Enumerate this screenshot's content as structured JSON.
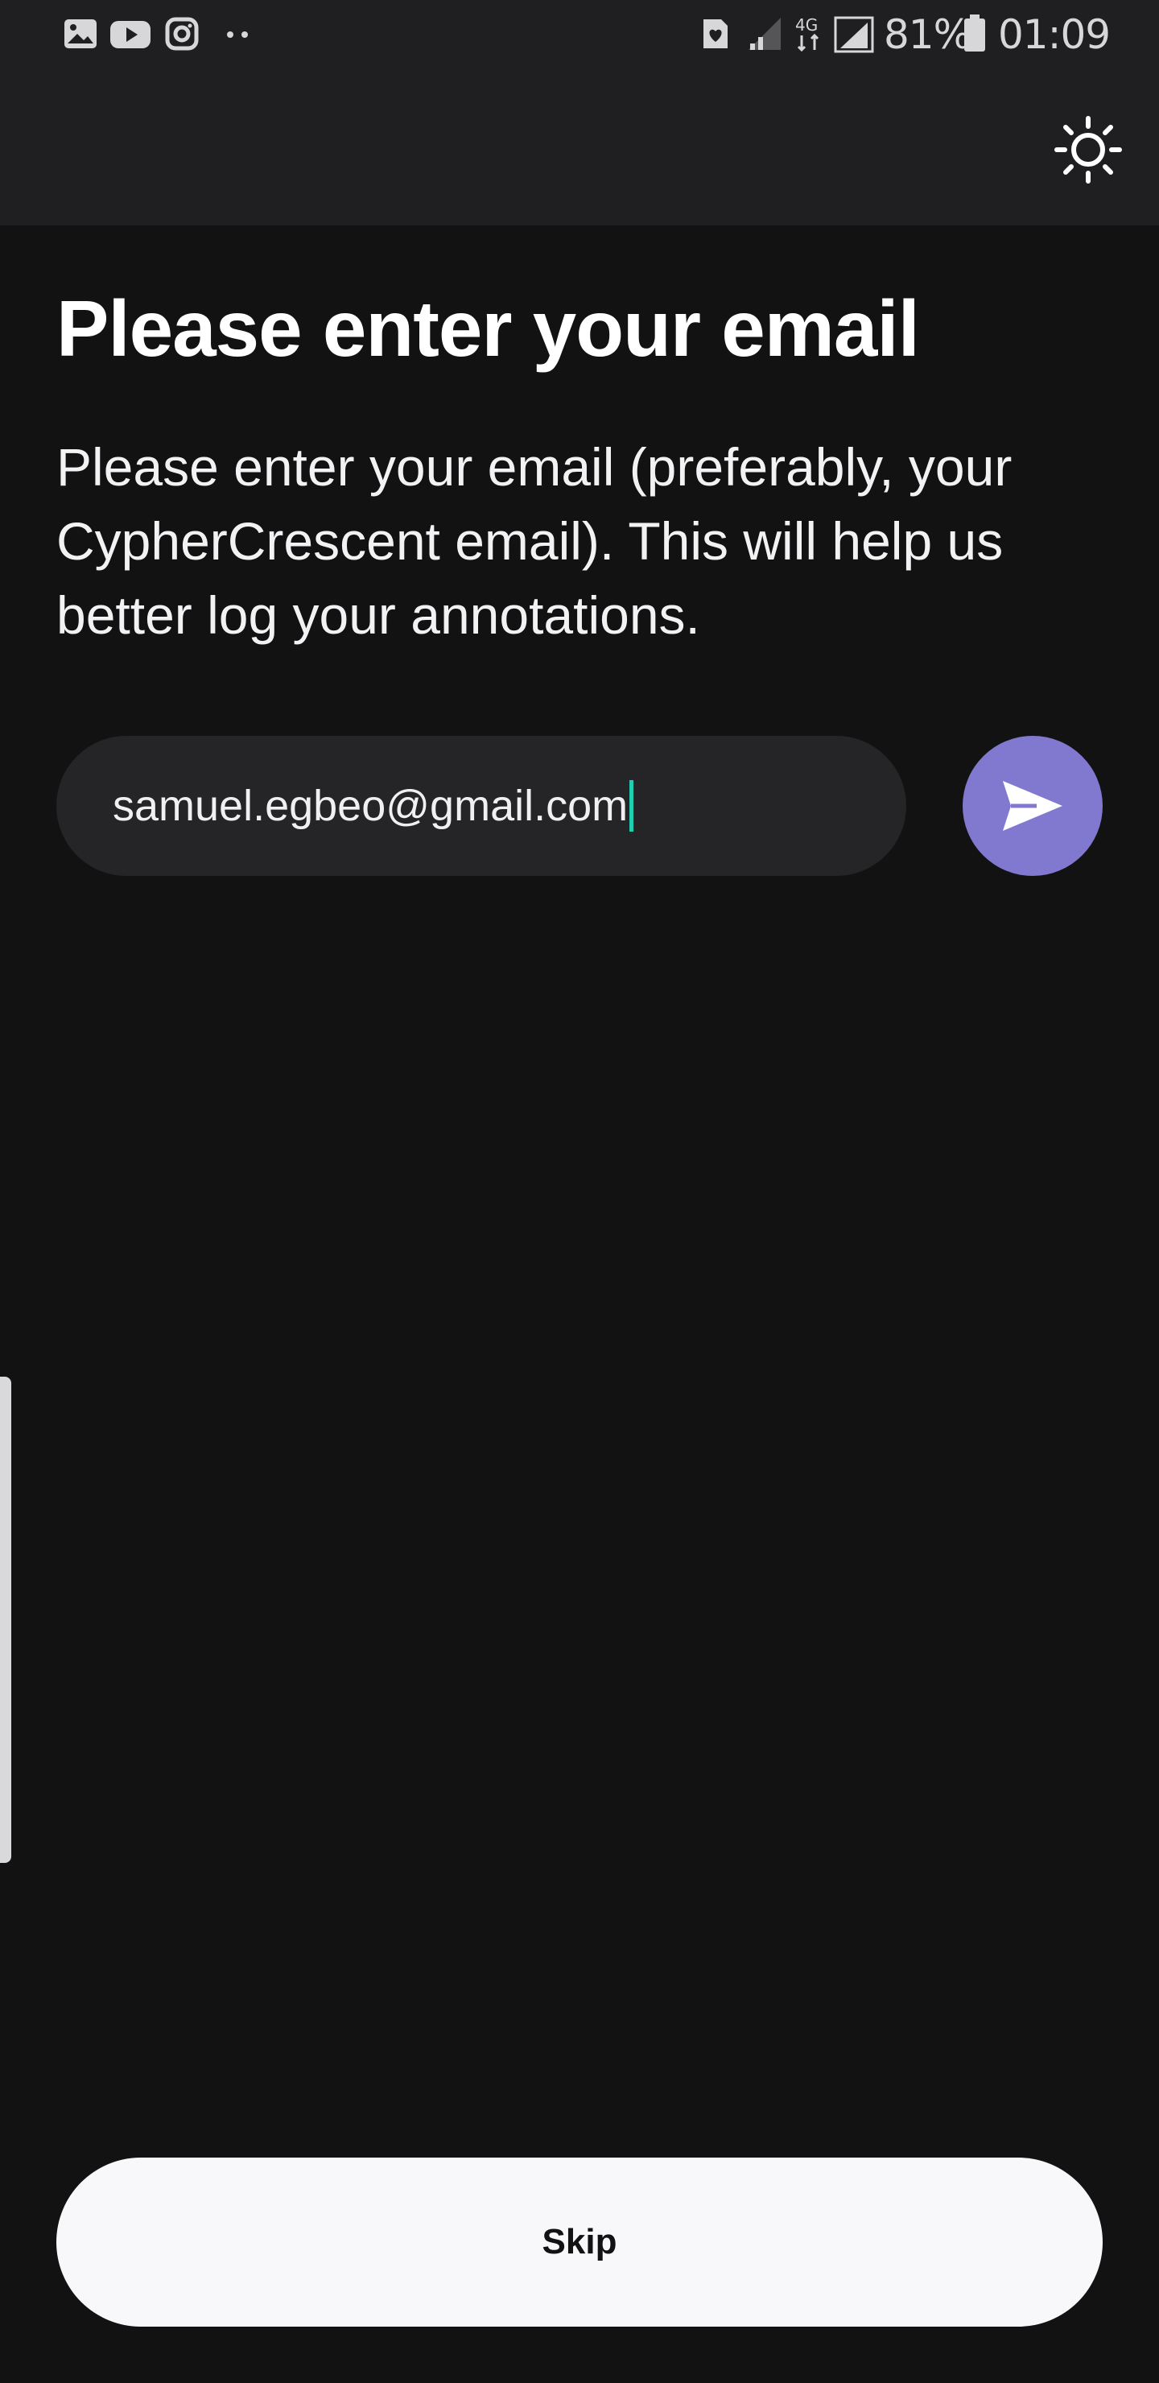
{
  "status_bar": {
    "notification_icons": [
      "gallery-icon",
      "youtube-icon",
      "instagram-icon",
      "more-dots-icon"
    ],
    "system_icons": [
      "saved-heart-icon",
      "signal-weak-icon",
      "network-4g-icon",
      "signal-icon",
      "battery-icon"
    ],
    "network_label": "4G",
    "battery": "81%",
    "time": "01:09"
  },
  "app_bar": {
    "theme_toggle_icon": "sun-icon"
  },
  "content": {
    "title": "Please enter your email",
    "description": "Please enter your email (preferably, your CypherCrescent email). This will help us better log your annotations.",
    "email_value": "samuel.egbeo@gmail.com",
    "send_icon": "send-icon"
  },
  "footer": {
    "skip_label": "Skip"
  },
  "colors": {
    "background": "#121213",
    "bar": "#1f1f21",
    "input": "#252527",
    "accent": "#8079cf",
    "caret": "#1fcfb0",
    "skip_button": "#f8f8fa"
  }
}
